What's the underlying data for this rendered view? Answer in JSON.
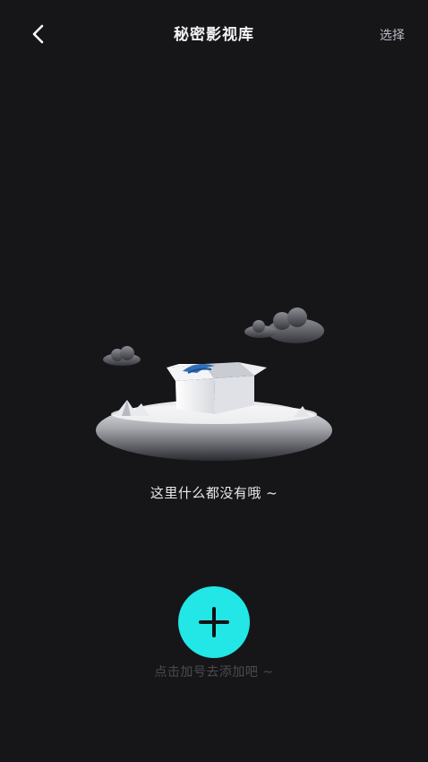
{
  "header": {
    "back_icon": "chevron-left-icon",
    "title": "秘密影视库",
    "select_label": "选择"
  },
  "empty_state": {
    "illustration": "empty-box-on-island-illustration",
    "message": "这里什么都没有哦 ~"
  },
  "add": {
    "icon": "plus-icon",
    "hint": "点击加号去添加吧 ~"
  },
  "colors": {
    "background": "#161619",
    "accent": "#22e7e6",
    "title_text": "#f2f2f4",
    "hint_text": "#4a4b50"
  }
}
